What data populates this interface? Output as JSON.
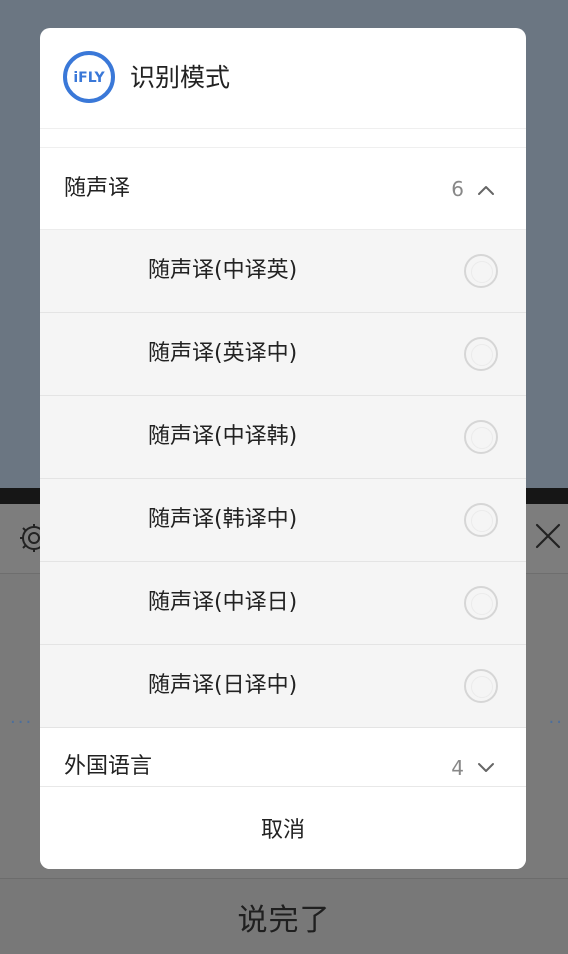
{
  "background": {
    "done_button_label": "说完了",
    "icons": [
      "gear-icon",
      "close-icon"
    ]
  },
  "dialog": {
    "title": "识别模式",
    "logo_text": "iFLY",
    "colors": {
      "accent": "#3a78d8",
      "count": "#888888",
      "text": "#222222"
    },
    "groups": [
      {
        "label": "随声译",
        "count": "6",
        "expanded": true,
        "options": [
          {
            "label": "随声译(中译英)",
            "selected": false
          },
          {
            "label": "随声译(英译中)",
            "selected": false
          },
          {
            "label": "随声译(中译韩)",
            "selected": false
          },
          {
            "label": "随声译(韩译中)",
            "selected": false
          },
          {
            "label": "随声译(中译日)",
            "selected": false
          },
          {
            "label": "随声译(日译中)",
            "selected": false
          }
        ]
      },
      {
        "label": "外国语言",
        "count": "4",
        "expanded": false
      }
    ],
    "cancel_label": "取消"
  }
}
